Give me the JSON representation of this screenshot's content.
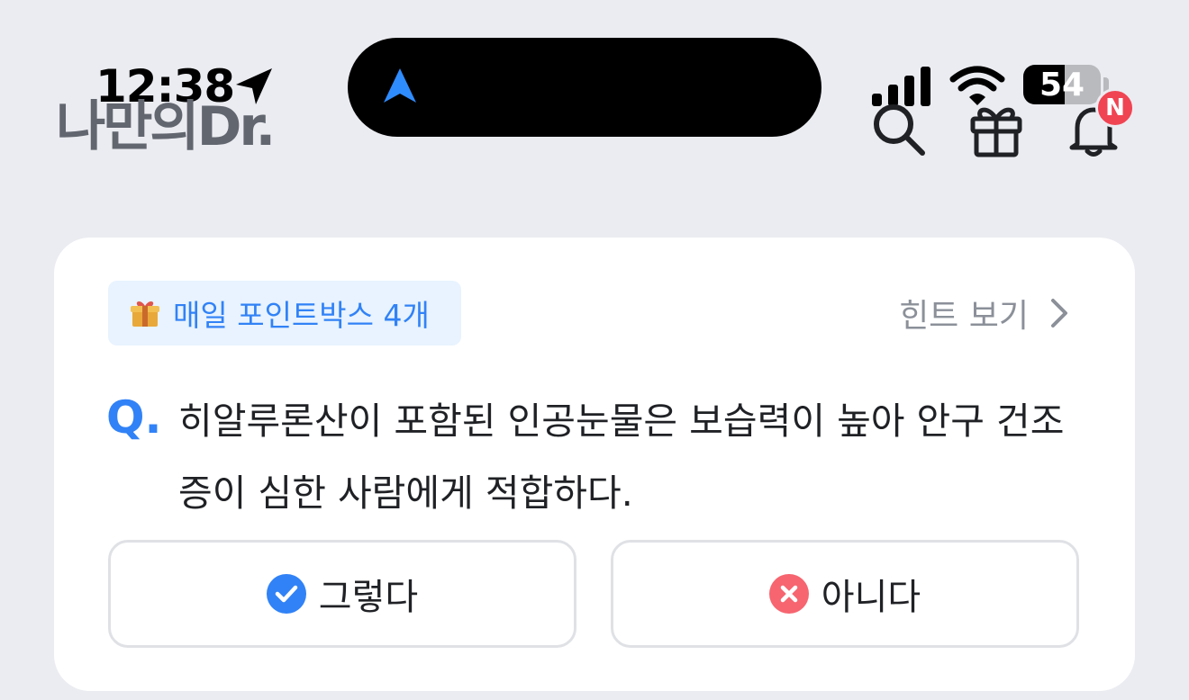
{
  "status_bar": {
    "time": "12:38",
    "battery_level": "54",
    "battery_fraction": 0.54
  },
  "header": {
    "logo_text": "나만의Dr.",
    "notification_badge": "N"
  },
  "quiz": {
    "point_chip": {
      "icon": "gift-emoji-icon",
      "label": "매일 포인트박스 4개"
    },
    "hint_label": "힌트 보기",
    "question_mark": "Q.",
    "question_text": "히알루론산이 포함된 인공눈물은 보습력이 높아 안구 건조증이 심한 사람에게 적합하다.",
    "answers": [
      {
        "label": "그렇다",
        "icon": "check-circle-icon",
        "color": "#3182f6"
      },
      {
        "label": "아니다",
        "icon": "x-circle-icon",
        "color": "#f66570"
      }
    ]
  },
  "colors": {
    "background": "#ebecf1",
    "accent_blue": "#3182f6",
    "chip_background": "#e8f3ff",
    "badge_red": "#f04452",
    "muted_text": "#8b9099",
    "logo_gray": "#62666f"
  }
}
